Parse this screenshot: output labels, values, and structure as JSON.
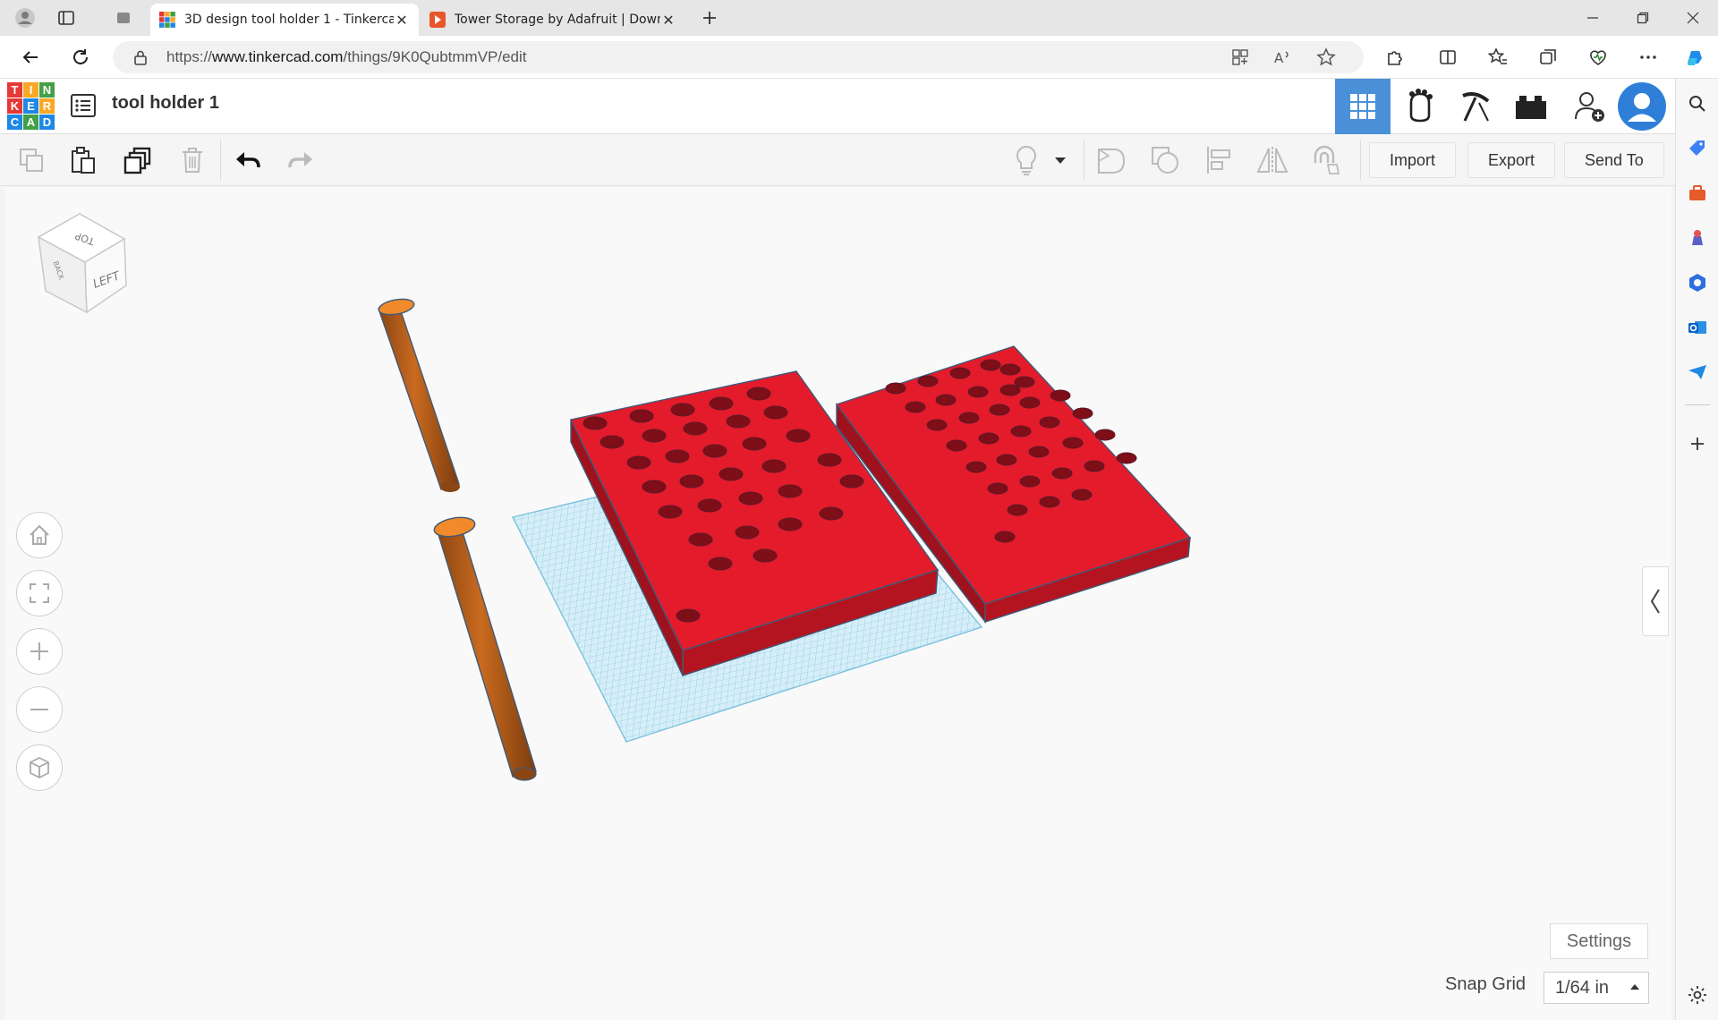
{
  "browser": {
    "tabs": [
      {
        "title": "3D design tool holder 1 - Tinkercad",
        "active": true
      },
      {
        "title": "Tower Storage by Adafruit | Download",
        "active": false
      }
    ],
    "url_prefix": "https://",
    "url_host": "www.tinkercad.com",
    "url_path": "/things/9K0QubtmmVP/edit"
  },
  "app": {
    "logo_letters": [
      "T",
      "I",
      "N",
      "K",
      "E",
      "R",
      "C",
      "A",
      "D"
    ],
    "logo_colors": [
      "#e53935",
      "#f9a825",
      "#43a047",
      "#e53935",
      "#1e88e5",
      "#f9a825",
      "#1e88e5",
      "#43a047",
      "#1e88e5"
    ],
    "design_title": "tool holder 1",
    "accent": "#4a90d9"
  },
  "toolbar": {
    "import_label": "Import",
    "export_label": "Export",
    "send_to_label": "Send To"
  },
  "viewport": {
    "viewcube_top": "TOP",
    "viewcube_front": "LEFT",
    "viewcube_side": "BACK",
    "settings_label": "Settings",
    "snap_grid_label": "Snap Grid",
    "snap_grid_value": "1/64 in",
    "shape_colors": {
      "box": "#d81e2d",
      "cylinder": "#c8651a",
      "grid": "#a8d8ec"
    }
  }
}
